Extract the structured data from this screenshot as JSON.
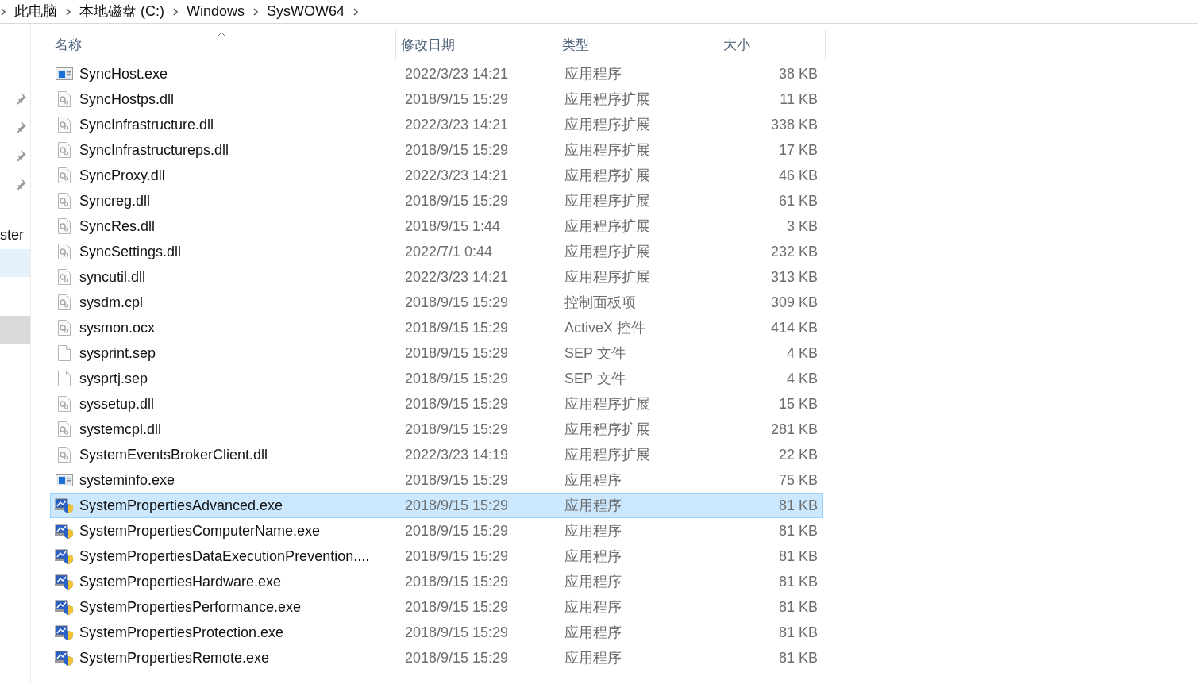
{
  "breadcrumb": [
    "此电脑",
    "本地磁盘 (C:)",
    "Windows",
    "SysWOW64"
  ],
  "sidebar": {
    "items": [
      {
        "kind": "pin",
        "selected": false
      },
      {
        "kind": "pin",
        "selected": false
      },
      {
        "kind": "pin",
        "selected": false
      },
      {
        "kind": "pin",
        "selected": false
      },
      {
        "kind": "text",
        "label": "ster",
        "selected": false
      },
      {
        "kind": "blank",
        "selected": true
      },
      {
        "kind": "blank",
        "selected": false,
        "focused": true
      }
    ]
  },
  "table": {
    "columns": [
      "名称",
      "修改日期",
      "类型",
      "大小"
    ],
    "rows": [
      {
        "kind": "app",
        "name": "SyncHost.exe",
        "date": "2022/3/23 14:21",
        "type": "应用程序",
        "size": "38 KB",
        "selected": false
      },
      {
        "kind": "extension",
        "name": "SyncHostps.dll",
        "date": "2018/9/15 15:29",
        "type": "应用程序扩展",
        "size": "11 KB",
        "selected": false
      },
      {
        "kind": "extension",
        "name": "SyncInfrastructure.dll",
        "date": "2022/3/23 14:21",
        "type": "应用程序扩展",
        "size": "338 KB",
        "selected": false
      },
      {
        "kind": "extension",
        "name": "SyncInfrastructureps.dll",
        "date": "2018/9/15 15:29",
        "type": "应用程序扩展",
        "size": "17 KB",
        "selected": false
      },
      {
        "kind": "extension",
        "name": "SyncProxy.dll",
        "date": "2022/3/23 14:21",
        "type": "应用程序扩展",
        "size": "46 KB",
        "selected": false
      },
      {
        "kind": "extension",
        "name": "Syncreg.dll",
        "date": "2018/9/15 15:29",
        "type": "应用程序扩展",
        "size": "61 KB",
        "selected": false
      },
      {
        "kind": "extension",
        "name": "SyncRes.dll",
        "date": "2018/9/15 1:44",
        "type": "应用程序扩展",
        "size": "3 KB",
        "selected": false
      },
      {
        "kind": "extension",
        "name": "SyncSettings.dll",
        "date": "2022/7/1 0:44",
        "type": "应用程序扩展",
        "size": "232 KB",
        "selected": false
      },
      {
        "kind": "extension",
        "name": "syncutil.dll",
        "date": "2022/3/23 14:21",
        "type": "应用程序扩展",
        "size": "313 KB",
        "selected": false
      },
      {
        "kind": "extension",
        "name": "sysdm.cpl",
        "date": "2018/9/15 15:29",
        "type": "控制面板项",
        "size": "309 KB",
        "selected": false
      },
      {
        "kind": "extension",
        "name": "sysmon.ocx",
        "date": "2018/9/15 15:29",
        "type": "ActiveX 控件",
        "size": "414 KB",
        "selected": false
      },
      {
        "kind": "blank",
        "name": "sysprint.sep",
        "date": "2018/9/15 15:29",
        "type": "SEP 文件",
        "size": "4 KB",
        "selected": false
      },
      {
        "kind": "blank",
        "name": "sysprtj.sep",
        "date": "2018/9/15 15:29",
        "type": "SEP 文件",
        "size": "4 KB",
        "selected": false
      },
      {
        "kind": "extension",
        "name": "syssetup.dll",
        "date": "2018/9/15 15:29",
        "type": "应用程序扩展",
        "size": "15 KB",
        "selected": false
      },
      {
        "kind": "extension",
        "name": "systemcpl.dll",
        "date": "2018/9/15 15:29",
        "type": "应用程序扩展",
        "size": "281 KB",
        "selected": false
      },
      {
        "kind": "extension",
        "name": "SystemEventsBrokerClient.dll",
        "date": "2022/3/23 14:19",
        "type": "应用程序扩展",
        "size": "22 KB",
        "selected": false
      },
      {
        "kind": "app",
        "name": "systeminfo.exe",
        "date": "2018/9/15 15:29",
        "type": "应用程序",
        "size": "75 KB",
        "selected": false
      },
      {
        "kind": "shield",
        "name": "SystemPropertiesAdvanced.exe",
        "date": "2018/9/15 15:29",
        "type": "应用程序",
        "size": "81 KB",
        "selected": true
      },
      {
        "kind": "shield",
        "name": "SystemPropertiesComputerName.exe",
        "date": "2018/9/15 15:29",
        "type": "应用程序",
        "size": "81 KB",
        "selected": false
      },
      {
        "kind": "shield",
        "name": "SystemPropertiesDataExecutionPrevention....",
        "date": "2018/9/15 15:29",
        "type": "应用程序",
        "size": "81 KB",
        "selected": false
      },
      {
        "kind": "shield",
        "name": "SystemPropertiesHardware.exe",
        "date": "2018/9/15 15:29",
        "type": "应用程序",
        "size": "81 KB",
        "selected": false
      },
      {
        "kind": "shield",
        "name": "SystemPropertiesPerformance.exe",
        "date": "2018/9/15 15:29",
        "type": "应用程序",
        "size": "81 KB",
        "selected": false
      },
      {
        "kind": "shield",
        "name": "SystemPropertiesProtection.exe",
        "date": "2018/9/15 15:29",
        "type": "应用程序",
        "size": "81 KB",
        "selected": false
      },
      {
        "kind": "shield",
        "name": "SystemPropertiesRemote.exe",
        "date": "2018/9/15 15:29",
        "type": "应用程序",
        "size": "81 KB",
        "selected": false
      }
    ]
  }
}
